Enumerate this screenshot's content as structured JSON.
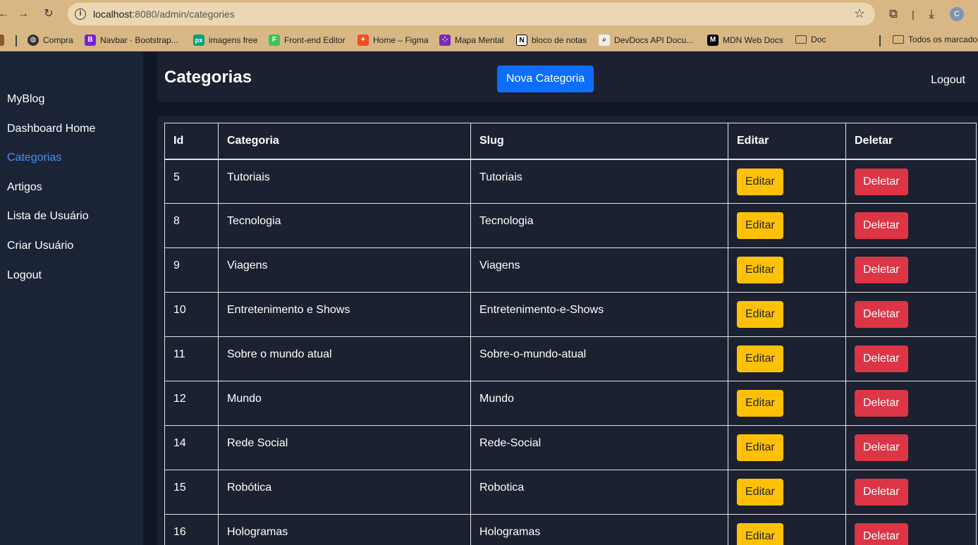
{
  "browser": {
    "url_host": "localhost",
    "url_path": ":8080/admin/categories",
    "bookmarks": [
      {
        "label": "Compra",
        "icon": "globe-icon"
      },
      {
        "label": "Navbar · Bootstrap...",
        "icon": "bootstrap-icon"
      },
      {
        "label": "imagens free",
        "icon": "pexels-icon"
      },
      {
        "label": "Front-end Editor",
        "icon": "frontend-editor-icon"
      },
      {
        "label": "Home – Figma",
        "icon": "figma-icon"
      },
      {
        "label": "Mapa Mental",
        "icon": "mindmap-icon"
      },
      {
        "label": "bloco de notas",
        "icon": "notion-icon"
      },
      {
        "label": "DevDocs API Docu...",
        "icon": "devdocs-icon"
      },
      {
        "label": "MDN Web Docs",
        "icon": "mdn-icon"
      },
      {
        "label": "Doc",
        "icon": "folder-icon"
      },
      {
        "label": "Todos os marcado",
        "icon": "folder-icon"
      }
    ],
    "avatar_letter": "C"
  },
  "sidebar": {
    "items": [
      {
        "label": "MyBlog",
        "active": false
      },
      {
        "label": "Dashboard Home",
        "active": false
      },
      {
        "label": "Categorias",
        "active": true
      },
      {
        "label": "Artigos",
        "active": false
      },
      {
        "label": "Lista de Usuário",
        "active": false
      },
      {
        "label": "Criar Usuário",
        "active": false
      },
      {
        "label": "Logout",
        "active": false
      }
    ]
  },
  "header": {
    "title": "Categorias",
    "new_button": "Nova Categoria",
    "logout": "Logout"
  },
  "table": {
    "columns": [
      "Id",
      "Categoria",
      "Slug",
      "Editar",
      "Deletar"
    ],
    "edit_label": "Editar",
    "delete_label": "Deletar",
    "rows": [
      {
        "id": "5",
        "categoria": "Tutoriais",
        "slug": "Tutoriais"
      },
      {
        "id": "8",
        "categoria": "Tecnologia",
        "slug": "Tecnologia"
      },
      {
        "id": "9",
        "categoria": "Viagens",
        "slug": "Viagens"
      },
      {
        "id": "10",
        "categoria": "Entretenimento e Shows",
        "slug": "Entretenimento-e-Shows"
      },
      {
        "id": "11",
        "categoria": "Sobre o mundo atual",
        "slug": "Sobre-o-mundo-atual"
      },
      {
        "id": "12",
        "categoria": "Mundo",
        "slug": "Mundo"
      },
      {
        "id": "14",
        "categoria": "Rede Social",
        "slug": "Rede-Social"
      },
      {
        "id": "15",
        "categoria": "Robótica",
        "slug": "Robotica"
      },
      {
        "id": "16",
        "categoria": "Hologramas",
        "slug": "Hologramas"
      }
    ]
  },
  "colors": {
    "primary": "#0d6efd",
    "warning": "#ffc107",
    "danger": "#dc3545",
    "active_link": "#4a8ff3"
  }
}
